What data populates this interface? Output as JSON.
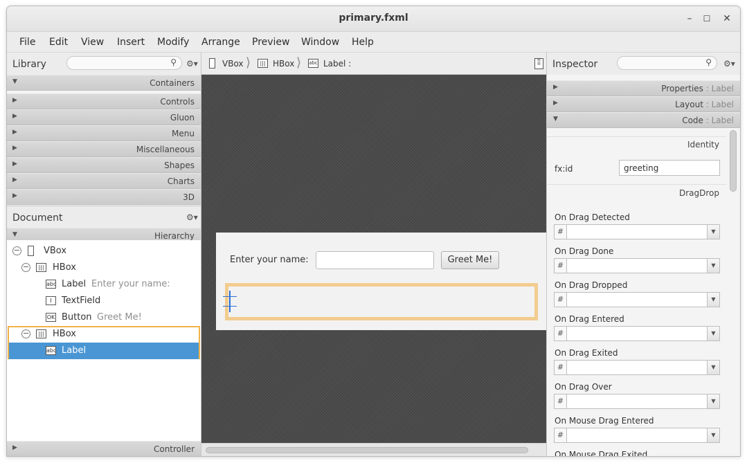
{
  "window": {
    "title": "primary.fxml",
    "controls": [
      "–",
      "☐",
      "✕"
    ]
  },
  "menu": [
    "File",
    "Edit",
    "View",
    "Insert",
    "Modify",
    "Arrange",
    "Preview",
    "Window",
    "Help"
  ],
  "library": {
    "title": "Library",
    "search_placeholder": "",
    "sections": [
      "Containers",
      "Controls",
      "Gluon",
      "Menu",
      "Miscellaneous",
      "Shapes",
      "Charts",
      "3D"
    ]
  },
  "document": {
    "title": "Document",
    "hierarchy_label": "Hierarchy",
    "controller_label": "Controller",
    "tree": [
      {
        "type": "VBox",
        "value": ""
      },
      {
        "type": "HBox",
        "value": ""
      },
      {
        "type": "Label",
        "value": "Enter your name:"
      },
      {
        "type": "TextField",
        "value": ""
      },
      {
        "type": "Button",
        "value": "Greet Me!"
      },
      {
        "type": "HBox",
        "value": ""
      },
      {
        "type": "Label",
        "value": ""
      }
    ]
  },
  "breadcrumb": {
    "items": [
      "VBox",
      "HBox",
      "Label :"
    ]
  },
  "canvas": {
    "prompt": "Enter your name:",
    "button": "Greet Me!"
  },
  "inspector": {
    "title": "Inspector",
    "sections": [
      {
        "name": "Properties",
        "sub": ": Label"
      },
      {
        "name": "Layout",
        "sub": ": Label"
      },
      {
        "name": "Code",
        "sub": ": Label"
      }
    ],
    "identity_title": "Identity",
    "fxid_label": "fx:id",
    "fxid_value": "greeting",
    "dragdrop_title": "DragDrop",
    "events": [
      "On Drag Detected",
      "On Drag Done",
      "On Drag Dropped",
      "On Drag Entered",
      "On Drag Exited",
      "On Drag Over",
      "On Mouse Drag Entered",
      "On Mouse Drag Exited"
    ],
    "hash": "#"
  },
  "colors": {
    "selection": "#4a96d4",
    "highlight_border": "#f0b247",
    "canvas_bg": "#4b4b4b",
    "resize_handle": "#2f6fd6"
  }
}
